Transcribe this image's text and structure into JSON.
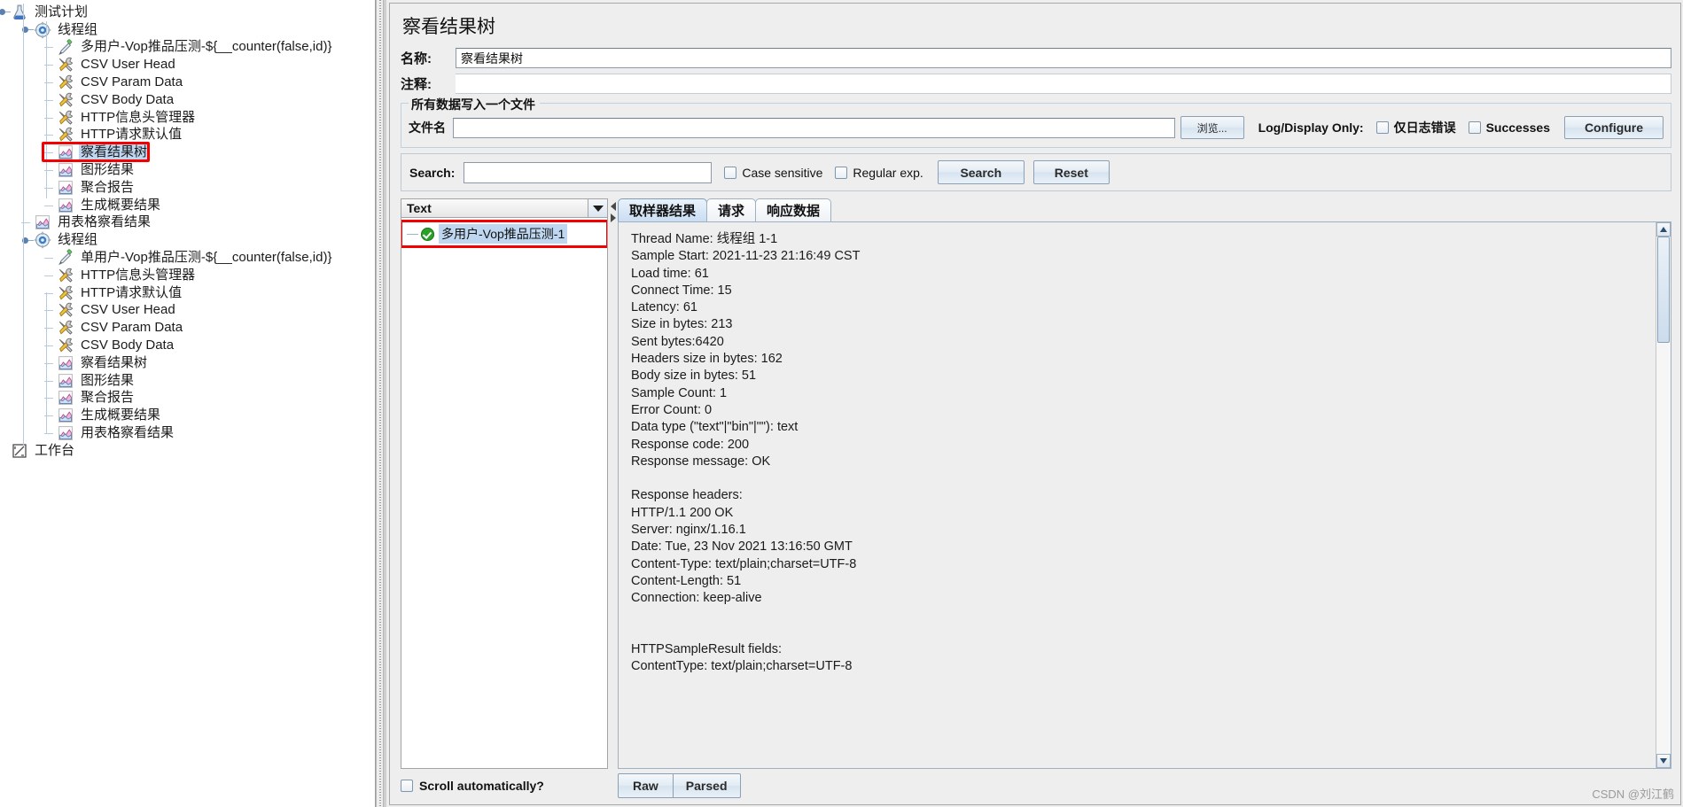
{
  "tree": {
    "items": [
      {
        "label": "测试计划",
        "icon": "test-plan-icon",
        "depth": 0,
        "expander": true
      },
      {
        "label": "线程组",
        "icon": "thread-group-icon",
        "depth": 1,
        "expander": true
      },
      {
        "label": "多用户-Vop推品压测-${__counter(false,id)}",
        "icon": "http-sampler-icon",
        "depth": 2,
        "expander": false
      },
      {
        "label": "CSV User Head",
        "icon": "config-element-icon",
        "depth": 2,
        "expander": false
      },
      {
        "label": "CSV Param Data",
        "icon": "config-element-icon",
        "depth": 2,
        "expander": false
      },
      {
        "label": "CSV Body Data",
        "icon": "config-element-icon",
        "depth": 2,
        "expander": false
      },
      {
        "label": "HTTP信息头管理器",
        "icon": "config-element-icon",
        "depth": 2,
        "expander": false
      },
      {
        "label": "HTTP请求默认值",
        "icon": "config-element-icon",
        "depth": 2,
        "expander": false
      },
      {
        "label": "察看结果树",
        "icon": "listener-icon",
        "depth": 2,
        "expander": false,
        "selected": true,
        "annotated": true
      },
      {
        "label": "图形结果",
        "icon": "listener-icon",
        "depth": 2,
        "expander": false
      },
      {
        "label": "聚合报告",
        "icon": "listener-icon",
        "depth": 2,
        "expander": false
      },
      {
        "label": "生成概要结果",
        "icon": "listener-icon",
        "depth": 2,
        "expander": false,
        "last": true
      },
      {
        "label": "用表格察看结果",
        "icon": "listener-icon",
        "depth": 1,
        "expander": false
      },
      {
        "label": "线程组",
        "icon": "thread-group-icon",
        "depth": 1,
        "expander": true
      },
      {
        "label": "单用户-Vop推品压测-${__counter(false,id)}",
        "icon": "http-sampler-icon",
        "depth": 2,
        "expander": false
      },
      {
        "label": "HTTP信息头管理器",
        "icon": "config-element-icon",
        "depth": 2,
        "expander": false
      },
      {
        "label": "HTTP请求默认值",
        "icon": "config-element-icon",
        "depth": 2,
        "expander": false
      },
      {
        "label": "CSV User Head",
        "icon": "config-element-icon",
        "depth": 2,
        "expander": false
      },
      {
        "label": "CSV Param Data",
        "icon": "config-element-icon",
        "depth": 2,
        "expander": false
      },
      {
        "label": "CSV Body Data",
        "icon": "config-element-icon",
        "depth": 2,
        "expander": false
      },
      {
        "label": "察看结果树",
        "icon": "listener-icon",
        "depth": 2,
        "expander": false
      },
      {
        "label": "图形结果",
        "icon": "listener-icon",
        "depth": 2,
        "expander": false
      },
      {
        "label": "聚合报告",
        "icon": "listener-icon",
        "depth": 2,
        "expander": false
      },
      {
        "label": "生成概要结果",
        "icon": "listener-icon",
        "depth": 2,
        "expander": false
      },
      {
        "label": "用表格察看结果",
        "icon": "listener-icon",
        "depth": 2,
        "expander": false,
        "last": true
      },
      {
        "label": "工作台",
        "icon": "workbench-icon",
        "depth": 0,
        "expander": false
      }
    ]
  },
  "panel": {
    "title": "察看结果树",
    "name_label": "名称:",
    "name_value": "察看结果树",
    "comment_label": "注释:",
    "comment_value": "",
    "group_legend": "所有数据写入一个文件",
    "filename_label": "文件名",
    "filename_value": "",
    "filename_placeholder": "",
    "browse_button": "浏览...",
    "log_display_only_label": "Log/Display Only:",
    "errors_only_label": "仅日志错误",
    "successes_label": "Successes",
    "configure_button": "Configure"
  },
  "search": {
    "label": "Search:",
    "value": "",
    "placeholder": "",
    "case_sensitive_label": "Case sensitive",
    "regular_exp_label": "Regular exp.",
    "search_button": "Search",
    "reset_button": "Reset"
  },
  "results": {
    "view_selector_value": "Text",
    "rows": [
      {
        "label": "多用户-Vop推品压测-1",
        "status": "success",
        "selected": true,
        "annotated": true
      }
    ],
    "scroll_automatically_label": "Scroll automatically?"
  },
  "detail": {
    "tabs": [
      {
        "label": "取样器结果",
        "active": true
      },
      {
        "label": "请求",
        "active": false
      },
      {
        "label": "响应数据",
        "active": false
      }
    ],
    "sampler_result_text": "Thread Name: 线程组 1-1\nSample Start: 2021-11-23 21:16:49 CST\nLoad time: 61\nConnect Time: 15\nLatency: 61\nSize in bytes: 213\nSent bytes:6420\nHeaders size in bytes: 162\nBody size in bytes: 51\nSample Count: 1\nError Count: 0\nData type (\"text\"|\"bin\"|\"\"): text\nResponse code: 200\nResponse message: OK\n\nResponse headers:\nHTTP/1.1 200 OK\nServer: nginx/1.16.1\nDate: Tue, 23 Nov 2021 13:16:50 GMT\nContent-Type: text/plain;charset=UTF-8\nContent-Length: 51\nConnection: keep-alive\n\n\nHTTPSampleResult fields:\nContentType: text/plain;charset=UTF-8",
    "raw_button": "Raw",
    "parsed_button": "Parsed"
  },
  "watermark": "CSDN @刘江鹤",
  "colors": {
    "accent": "#bed6ef",
    "annotation": "#f50000",
    "success": "#2aa02a",
    "panel_bg": "#eeeeee"
  }
}
